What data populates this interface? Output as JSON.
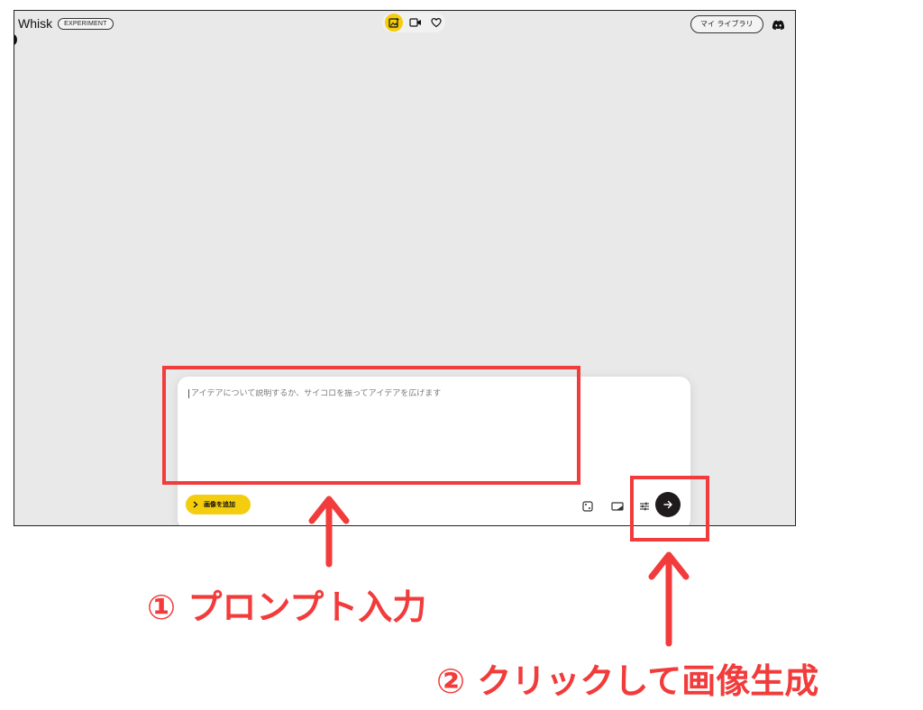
{
  "app": {
    "brand": "Whisk",
    "badge": "EXPERIMENT",
    "library_label": "マイ ライブラリ",
    "icons": {
      "image_mode": "image-spark-icon",
      "video_mode": "video-icon",
      "favorites": "heart-icon",
      "discord": "discord-icon"
    }
  },
  "composer": {
    "prompt_placeholder": "アイデアについて説明するか、サイコロを振ってアイデアを広げます",
    "add_image_label": "画像を追加",
    "tools": [
      "dice-icon",
      "aspect-ratio-icon",
      "settings-sliders-icon"
    ],
    "send_icon": "arrow-right-icon"
  },
  "annotations": {
    "step1": "① プロンプト入力",
    "step2": "② クリックして画像生成",
    "highlight_color": "#f23b3b"
  },
  "colors": {
    "accent_yellow": "#f5cd0f",
    "canvas_bg": "#e9e9e9",
    "send_button": "#1f1a1c"
  }
}
